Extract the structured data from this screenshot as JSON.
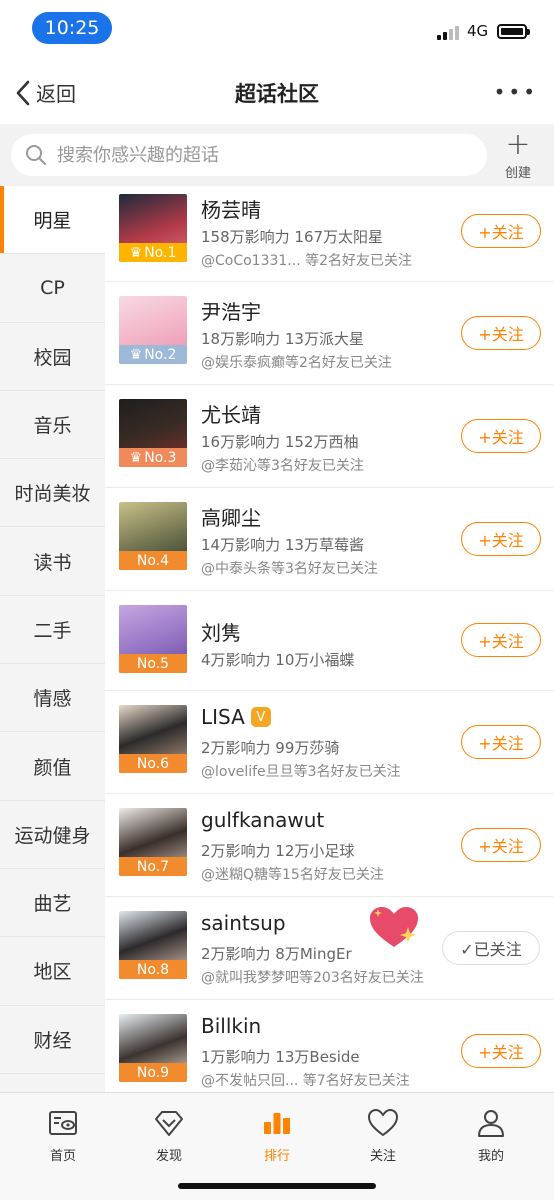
{
  "status_bar": {
    "time": "10:25",
    "network": "4G"
  },
  "nav": {
    "back_label": "返回",
    "title": "超话社区",
    "more_label": "•••"
  },
  "search": {
    "placeholder": "搜索你感兴趣的超话",
    "create_label": "创建"
  },
  "sidebar": {
    "items": [
      {
        "label": "明星",
        "active": true
      },
      {
        "label": "CP"
      },
      {
        "label": "校园"
      },
      {
        "label": "音乐"
      },
      {
        "label": "时尚美妆"
      },
      {
        "label": "读书"
      },
      {
        "label": "二手"
      },
      {
        "label": "情感"
      },
      {
        "label": "颜值"
      },
      {
        "label": "运动健身"
      },
      {
        "label": "曲艺"
      },
      {
        "label": "地区"
      },
      {
        "label": "财经"
      }
    ]
  },
  "list": {
    "items": [
      {
        "name": "杨芸晴",
        "rank": "No.1",
        "stats": "158万影响力 167万太阳星",
        "friends": "@CoCo1331...    等2名好友已关注",
        "button": "+关注"
      },
      {
        "name": "尹浩宇",
        "rank": "No.2",
        "stats": "18万影响力 13万派大星",
        "friends": "@娱乐泰疯癫等2名好友已关注",
        "button": "+关注"
      },
      {
        "name": "尤长靖",
        "rank": "No.3",
        "stats": "16万影响力 152万西柚",
        "friends": "@李茹沁等3名好友已关注",
        "button": "+关注"
      },
      {
        "name": "高卿尘",
        "rank": "No.4",
        "stats": "14万影响力 13万草莓酱",
        "friends": "@中泰头条等3名好友已关注",
        "button": "+关注"
      },
      {
        "name": "刘隽",
        "rank": "No.5",
        "stats": "4万影响力 10万小福蝶",
        "friends": "",
        "button": "+关注"
      },
      {
        "name": "LISA",
        "rank": "No.6",
        "stats": "2万影响力 99万莎骑",
        "friends": "@lovelife旦旦等3名好友已关注",
        "button": "+关注",
        "verified": "V"
      },
      {
        "name": "gulfkanawut",
        "rank": "No.7",
        "stats": "2万影响力 12万小足球",
        "friends": "@迷糊Q糖等15名好友已关注",
        "button": "+关注"
      },
      {
        "name": "saintsup",
        "rank": "No.8",
        "stats": "2万影响力 8万MingEr",
        "friends": "@就叫我梦梦吧等203名好友已关注",
        "button": "✓已关注"
      },
      {
        "name": "Billkin",
        "rank": "No.9",
        "stats": "1万影响力 13万Beside",
        "friends": "@不发帖只回...    等7名好友已关注",
        "button": "+关注"
      }
    ]
  },
  "tabbar": {
    "items": [
      {
        "label": "首页",
        "icon": "home-icon"
      },
      {
        "label": "发现",
        "icon": "discover-icon"
      },
      {
        "label": "排行",
        "icon": "rank-icon",
        "active": true
      },
      {
        "label": "关注",
        "icon": "heart-icon"
      },
      {
        "label": "我的",
        "icon": "profile-icon"
      }
    ]
  },
  "colors": {
    "accent": "#ff8200",
    "rank_gold": "#ffb400",
    "rank_silver": "#9eb8d8",
    "rank_bronze": "#f08a5a"
  }
}
